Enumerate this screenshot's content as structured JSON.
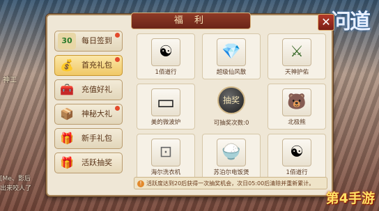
{
  "panel": {
    "title": "福 利",
    "close_label": "✕"
  },
  "sidebar": {
    "items": [
      {
        "label": "每日签到",
        "icon": "calendar-icon",
        "glyph": "30",
        "active": false,
        "dot": true
      },
      {
        "label": "首充礼包",
        "icon": "money-bag-icon",
        "glyph": "💰",
        "active": true,
        "dot": true
      },
      {
        "label": "充值好礼",
        "icon": "treasure-chest-icon",
        "glyph": "🧰",
        "active": false,
        "dot": false
      },
      {
        "label": "神秘大礼",
        "icon": "gold-chest-icon",
        "glyph": "📦",
        "active": false,
        "dot": true
      },
      {
        "label": "新手礼包",
        "icon": "gift-box-icon",
        "glyph": "🎁",
        "active": false,
        "dot": false
      },
      {
        "label": "活跃抽奖",
        "icon": "lottery-gift-icon",
        "glyph": "🎁",
        "active": false,
        "dot": false
      }
    ]
  },
  "rewards": [
    {
      "label": "1佰道行",
      "icon": "yin-yang-icon",
      "glyph": "☯"
    },
    {
      "label": "超级仙风散",
      "icon": "pink-gem-icon",
      "glyph": "💎"
    },
    {
      "label": "天神护佑",
      "icon": "sword-icon",
      "glyph": "⚔"
    },
    {
      "label": "美的微波炉",
      "icon": "microwave-icon",
      "glyph": "▭"
    },
    {
      "label": "北极熊",
      "icon": "polar-bear-pet-icon",
      "glyph": "🐻"
    },
    {
      "label": "海尔洗衣机",
      "icon": "washing-machine-icon",
      "glyph": "⊡"
    },
    {
      "label": "苏泊尔电饭煲",
      "icon": "rice-cooker-icon",
      "glyph": "🍚"
    },
    {
      "label": "1佰道行",
      "icon": "yin-yang-icon",
      "glyph": "☯"
    }
  ],
  "lottery": {
    "button_label": "抽奖",
    "count_text": "可抽奖次数:0"
  },
  "notice": {
    "text": "活跃度达到20后获得一次抽奖机会，次日05:00后清除并重新累计。"
  },
  "left_panel": {
    "label": "神工",
    "chat": [
      "[Me、影后",
      "出来咬人了"
    ]
  },
  "watermark": "第4手游"
}
